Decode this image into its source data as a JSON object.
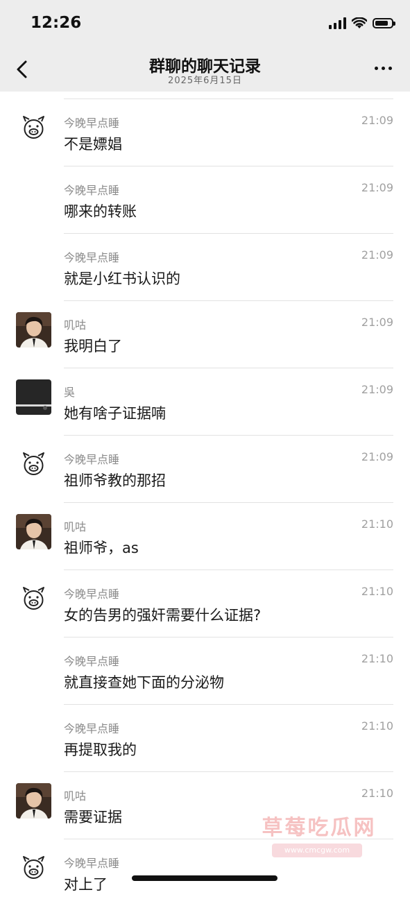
{
  "status_bar": {
    "time": "12:26"
  },
  "header": {
    "title": "群聊的聊天记录",
    "date": "2025年6月15日"
  },
  "messages": [
    {
      "avatar": "pig",
      "sender": "今晚早点睡",
      "time": "21:09",
      "text": "不是嫖娼"
    },
    {
      "avatar": "none",
      "sender": "今晚早点睡",
      "time": "21:09",
      "text": "哪来的转账"
    },
    {
      "avatar": "none",
      "sender": "今晚早点睡",
      "time": "21:09",
      "text": "就是小红书认识的"
    },
    {
      "avatar": "photo",
      "sender": "叽咕",
      "time": "21:09",
      "text": "我明白了"
    },
    {
      "avatar": "dark",
      "sender": "吳",
      "time": "21:09",
      "text": "她有啥子证据喃"
    },
    {
      "avatar": "pig",
      "sender": "今晚早点睡",
      "time": "21:09",
      "text": "祖师爷教的那招"
    },
    {
      "avatar": "photo",
      "sender": "叽咕",
      "time": "21:10",
      "text": "祖师爷，as"
    },
    {
      "avatar": "pig",
      "sender": "今晚早点睡",
      "time": "21:10",
      "text": "女的告男的强奸需要什么证据?"
    },
    {
      "avatar": "none",
      "sender": "今晚早点睡",
      "time": "21:10",
      "text": "就直接查她下面的分泌物"
    },
    {
      "avatar": "none",
      "sender": "今晚早点睡",
      "time": "21:10",
      "text": "再提取我的"
    },
    {
      "avatar": "photo",
      "sender": "叽咕",
      "time": "21:10",
      "text": "需要证据"
    },
    {
      "avatar": "pig",
      "sender": "今晚早点睡",
      "time": "",
      "text": "对上了"
    }
  ],
  "watermark": {
    "text": "草莓吃瓜网",
    "url": "www.cmcgw.com"
  }
}
